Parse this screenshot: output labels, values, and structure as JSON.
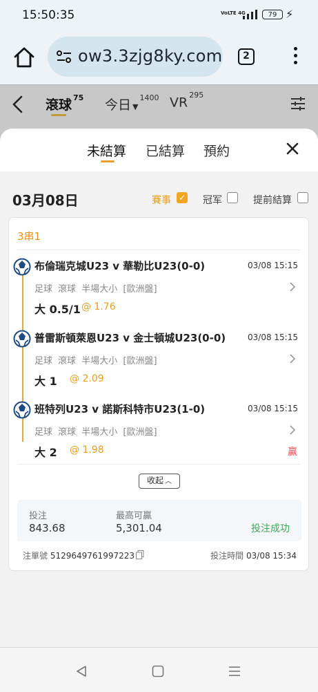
{
  "status_bar": {
    "time": "15:50:35",
    "signal_label": "VoLTE 4G",
    "battery": "79"
  },
  "browser": {
    "url": "ow3.3zjg8ky.com",
    "tab_count": "2"
  },
  "app_header": {
    "tabs": [
      {
        "label": "滾球",
        "count": "75"
      },
      {
        "label": "今日",
        "count": "1400"
      },
      {
        "label": "VR",
        "count": "295"
      }
    ]
  },
  "sheet": {
    "tabs": [
      {
        "label": "未結算",
        "active": true
      },
      {
        "label": "已結算",
        "active": false
      },
      {
        "label": "預約",
        "active": false
      }
    ],
    "date": "03月08日",
    "filters": [
      {
        "label": "賽事",
        "checked": true
      },
      {
        "label": "冠军",
        "checked": false
      },
      {
        "label": "提前結算",
        "checked": false
      }
    ]
  },
  "bet": {
    "parlay_type": "3串1",
    "legs": [
      {
        "match": "布倫瑞克城U23 v 華勒比U23(0-0)",
        "time": "03/08 15:15",
        "meta": "足球 滾球 半場大小 [歐洲盤]",
        "pick": "大 0.5/1",
        "odds": "@ 1.76",
        "result": ""
      },
      {
        "match": "普雷斯頓萊恩U23 v 金士頓城U23(0-0)",
        "time": "03/08 15:15",
        "meta": "足球 滾球 半場大小 [歐洲盤]",
        "pick": "大 1",
        "odds": "@ 2.09",
        "result": ""
      },
      {
        "match": "班特列U23 v 諾斯科特市U23(1-0)",
        "time": "03/08 15:15",
        "meta": "足球 滾球 半場大小 [歐洲盤]",
        "pick": "大 2",
        "odds": "@ 1.98",
        "result": "贏"
      }
    ],
    "collapse_label": "收起",
    "stake_label": "投注",
    "stake_value": "843.68",
    "max_win_label": "最高可贏",
    "max_win_value": "5,301.04",
    "status": "投注成功",
    "ticket_label": "注單號",
    "ticket_no": "5129649761997223",
    "bet_time_label": "投注時間",
    "bet_time": "03/08 15:34"
  },
  "colors": {
    "accent": "#e8a020",
    "win": "#e05a5a",
    "success": "#43a75b"
  }
}
